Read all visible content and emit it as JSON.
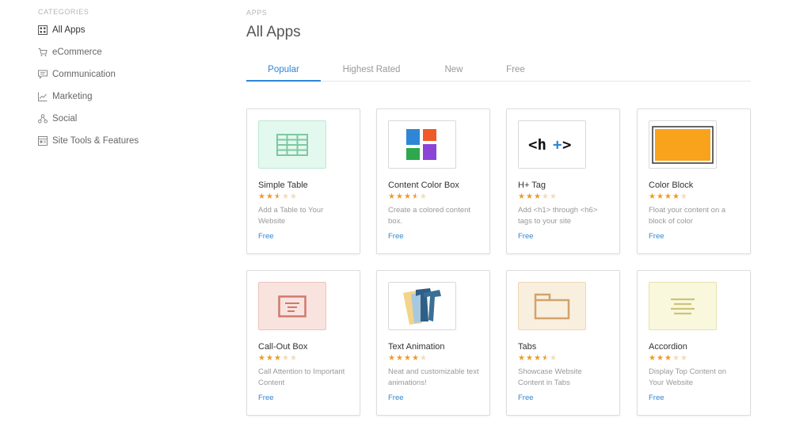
{
  "sidebar": {
    "heading": "CATEGORIES",
    "items": [
      {
        "label": "All Apps",
        "icon": "grid-icon"
      },
      {
        "label": "eCommerce",
        "icon": "cart-icon"
      },
      {
        "label": "Communication",
        "icon": "chat-icon"
      },
      {
        "label": "Marketing",
        "icon": "chart-icon"
      },
      {
        "label": "Social",
        "icon": "share-icon"
      },
      {
        "label": "Site Tools & Features",
        "icon": "tools-icon"
      }
    ]
  },
  "header": {
    "breadcrumb": "APPS",
    "title": "All Apps"
  },
  "tabs": [
    "Popular",
    "Highest Rated",
    "New",
    "Free"
  ],
  "apps": [
    {
      "name": "Simple Table",
      "rating": 2.5,
      "description": "Add a Table to Your Website",
      "price": "Free",
      "thumb_icon": "table-icon",
      "thumb_bg": "#e3f8ee"
    },
    {
      "name": "Content Color Box",
      "rating": 3.5,
      "description": "Create a colored content box.",
      "price": "Free",
      "thumb_icon": "color-squares-icon",
      "thumb_bg": "#ffffff"
    },
    {
      "name": "H+ Tag",
      "rating": 3,
      "description": "Add <h1> through <h6> tags to your site",
      "price": "Free",
      "thumb_icon": "h-plus-icon",
      "thumb_bg": "#ffffff"
    },
    {
      "name": "Color Block",
      "rating": 4,
      "description": "Float your content on a block of color",
      "price": "Free",
      "thumb_icon": "orange-block-icon",
      "thumb_bg": "#ffffff"
    },
    {
      "name": "Call-Out Box",
      "rating": 3,
      "description": "Call Attention to Important Content",
      "price": "Free",
      "thumb_icon": "callout-box-icon",
      "thumb_bg": "#f9e3df"
    },
    {
      "name": "Text Animation",
      "rating": 4,
      "description": "Neat and customizable text animations!",
      "price": "Free",
      "thumb_icon": "text-animation-icon",
      "thumb_bg": "#ffffff"
    },
    {
      "name": "Tabs",
      "rating": 3.5,
      "description": "Showcase Website Content in Tabs",
      "price": "Free",
      "thumb_icon": "tabs-icon",
      "thumb_bg": "#f9efdf"
    },
    {
      "name": "Accordion",
      "rating": 3,
      "description": "Display Top Content on Your Website",
      "price": "Free",
      "thumb_icon": "accordion-icon",
      "thumb_bg": "#f9f8dc"
    }
  ],
  "colors": {
    "accent": "#2f86d6",
    "star": "#f39a1f",
    "star_empty": "#f3dcb8"
  }
}
